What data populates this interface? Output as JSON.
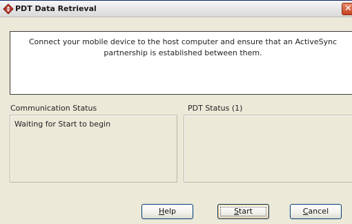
{
  "window": {
    "title": "PDT Data Retrieval",
    "title_icon": "diamond-arrows-icon",
    "close_icon": "close-icon"
  },
  "message": {
    "line1": "Connect your mobile device to the host computer and ensure that an ActiveSync",
    "line2": "partnership is established between them."
  },
  "communication": {
    "label": "Communication Status",
    "status_text": "Waiting for Start to begin"
  },
  "pdt": {
    "label": "PDT Status (1)"
  },
  "buttons": {
    "help": {
      "mnemonic": "H",
      "rest": "elp"
    },
    "start": {
      "mnemonic": "S",
      "rest": "tart"
    },
    "cancel": {
      "mnemonic": "C",
      "rest": "ancel"
    }
  },
  "colors": {
    "window_bg": "#ece9d8",
    "button_border": "#003c74",
    "close_red": "#c4411d"
  }
}
